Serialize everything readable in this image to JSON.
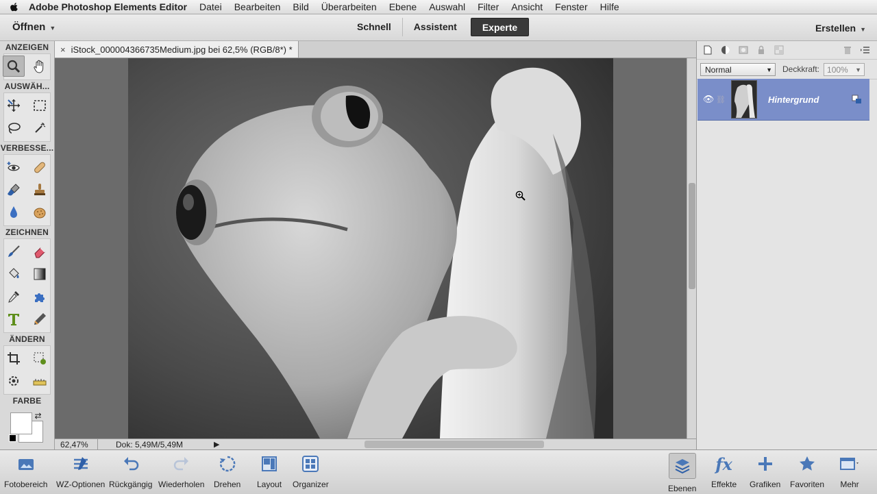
{
  "menubar": {
    "app_name": "Adobe Photoshop Elements Editor",
    "items": [
      "Datei",
      "Bearbeiten",
      "Bild",
      "Überarbeiten",
      "Ebene",
      "Auswahl",
      "Filter",
      "Ansicht",
      "Fenster",
      "Hilfe"
    ]
  },
  "topbar": {
    "open_label": "Öffnen",
    "mode_tabs": [
      "Schnell",
      "Assistent",
      "Experte"
    ],
    "active_tab": "Experte",
    "create_label": "Erstellen"
  },
  "toolbox": {
    "sections": {
      "view": "ANZEIGEN",
      "select": "AUSWÄH...",
      "enhance": "VERBESSE...",
      "draw": "ZEICHNEN",
      "modify": "ÄNDERN",
      "color": "FARBE"
    }
  },
  "document": {
    "tab_title": "iStock_000004366735Medium.jpg bei 62,5% (RGB/8*) *",
    "zoom": "62,47%",
    "doc_size": "Dok: 5,49M/5,49M"
  },
  "layers": {
    "blend_mode": "Normal",
    "opacity_label": "Deckkraft:",
    "opacity_value": "100%",
    "layer_name": "Hintergrund"
  },
  "bottombar": {
    "left_items": [
      "Fotobereich",
      "WZ-Optionen",
      "Rückgängig",
      "Wiederholen",
      "Drehen",
      "Layout",
      "Organizer"
    ],
    "right_items": [
      "Ebenen",
      "Effekte",
      "Grafiken",
      "Favoriten",
      "Mehr"
    ]
  },
  "colors": {
    "layer_selected": "#7a8ec9",
    "canvas_bg": "#6b6b6b",
    "active_mode_tab": "#3a3a3a",
    "panel_icon_blue": "#2e5fa8"
  }
}
